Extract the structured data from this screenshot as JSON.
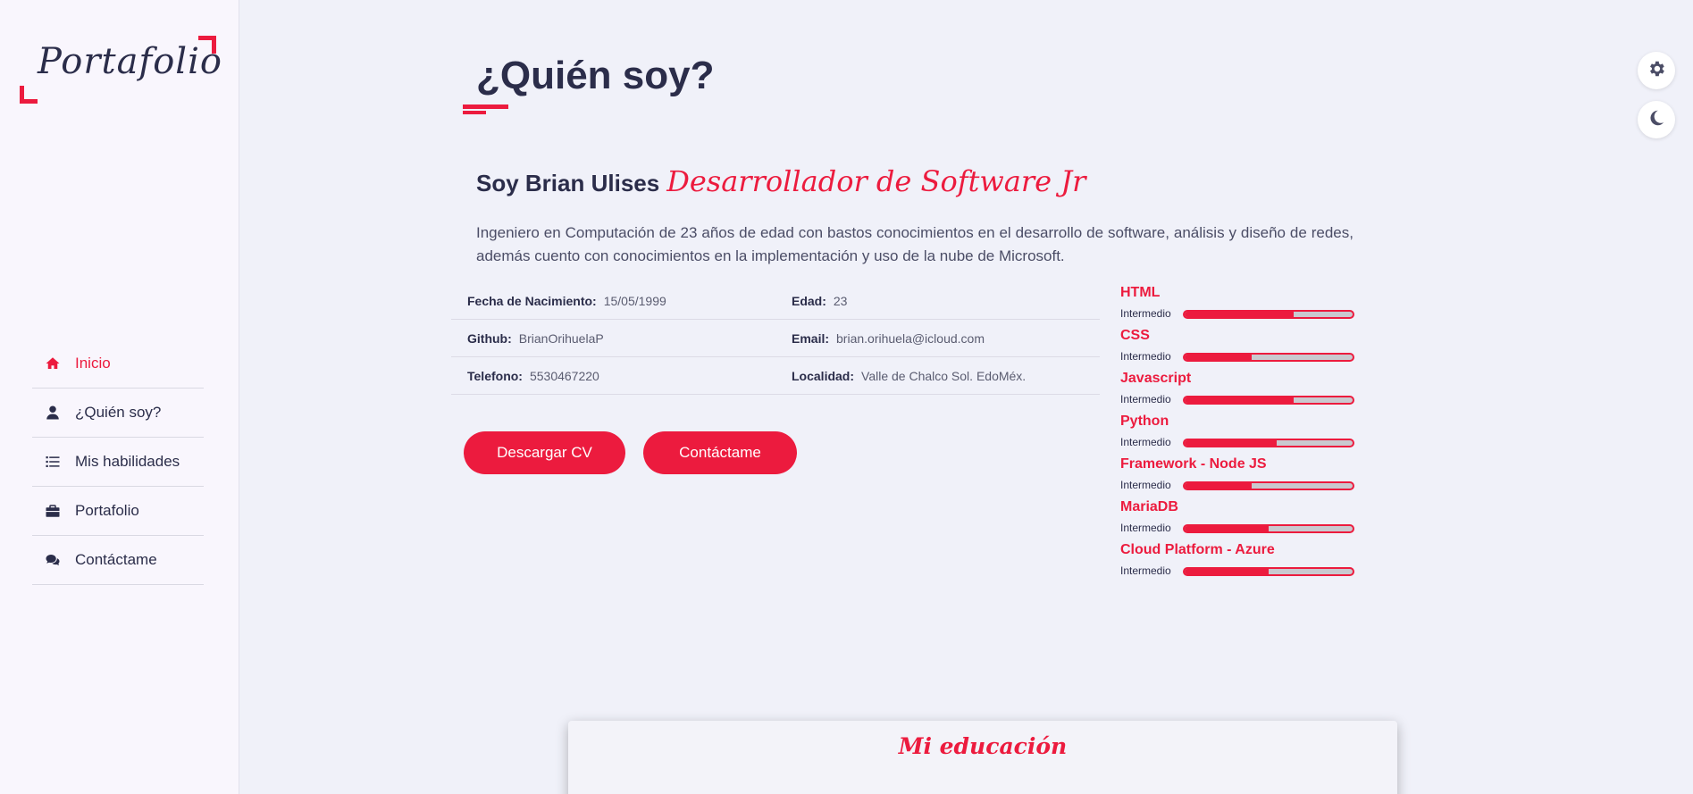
{
  "sidebar": {
    "logo": "Portafolio",
    "items": [
      {
        "label": "Inicio",
        "icon": "home-icon",
        "active": true
      },
      {
        "label": "¿Quién soy?",
        "icon": "user-icon",
        "active": false
      },
      {
        "label": "Mis habilidades",
        "icon": "list-icon",
        "active": false
      },
      {
        "label": "Portafolio",
        "icon": "briefcase-icon",
        "active": false
      },
      {
        "label": "Contáctame",
        "icon": "comments-icon",
        "active": false
      }
    ]
  },
  "main": {
    "title": "¿Quién soy?",
    "intro_name": "Soy Brian Ulises",
    "intro_role": "Desarrollador de Software Jr",
    "description": "Ingeniero en Computación de 23 años de edad con bastos conocimientos en el desarrollo de software, análisis y diseño de redes, además cuento con conocimientos en la implementación y uso de la nube de Microsoft.",
    "info": [
      [
        {
          "label": "Fecha de Nacimiento:",
          "value": "15/05/1999"
        },
        {
          "label": "Edad:",
          "value": "23"
        }
      ],
      [
        {
          "label": "Github:",
          "value": "BrianOrihuelaP"
        },
        {
          "label": "Email:",
          "value": "brian.orihuela@icloud.com"
        }
      ],
      [
        {
          "label": "Telefono:",
          "value": "5530467220"
        },
        {
          "label": "Localidad:",
          "value": "Valle de Chalco Sol. EdoMéx."
        }
      ]
    ],
    "buttons": {
      "download": "Descargar CV",
      "contact": "Contáctame"
    },
    "skills": [
      {
        "name": "HTML",
        "level": "Intermedio",
        "progress": 0.65
      },
      {
        "name": "CSS",
        "level": "Intermedio",
        "progress": 0.4
      },
      {
        "name": "Javascript",
        "level": "Intermedio",
        "progress": 0.65
      },
      {
        "name": "Python",
        "level": "Intermedio",
        "progress": 0.55
      },
      {
        "name": "Framework - Node JS",
        "level": "Intermedio",
        "progress": 0.4
      },
      {
        "name": "MariaDB",
        "level": "Intermedio",
        "progress": 0.5
      },
      {
        "name": "Cloud Platform - Azure",
        "level": "Intermedio",
        "progress": 0.5
      }
    ],
    "education_title": "Mi educación"
  },
  "colors": {
    "accent": "#ec1b3e",
    "text": "#2b2d4a",
    "background": "#f0f1f9",
    "sidebar": "#f9f6fd"
  },
  "floating": {
    "settings_icon": "gear-icon",
    "theme_icon": "moon-icon"
  }
}
